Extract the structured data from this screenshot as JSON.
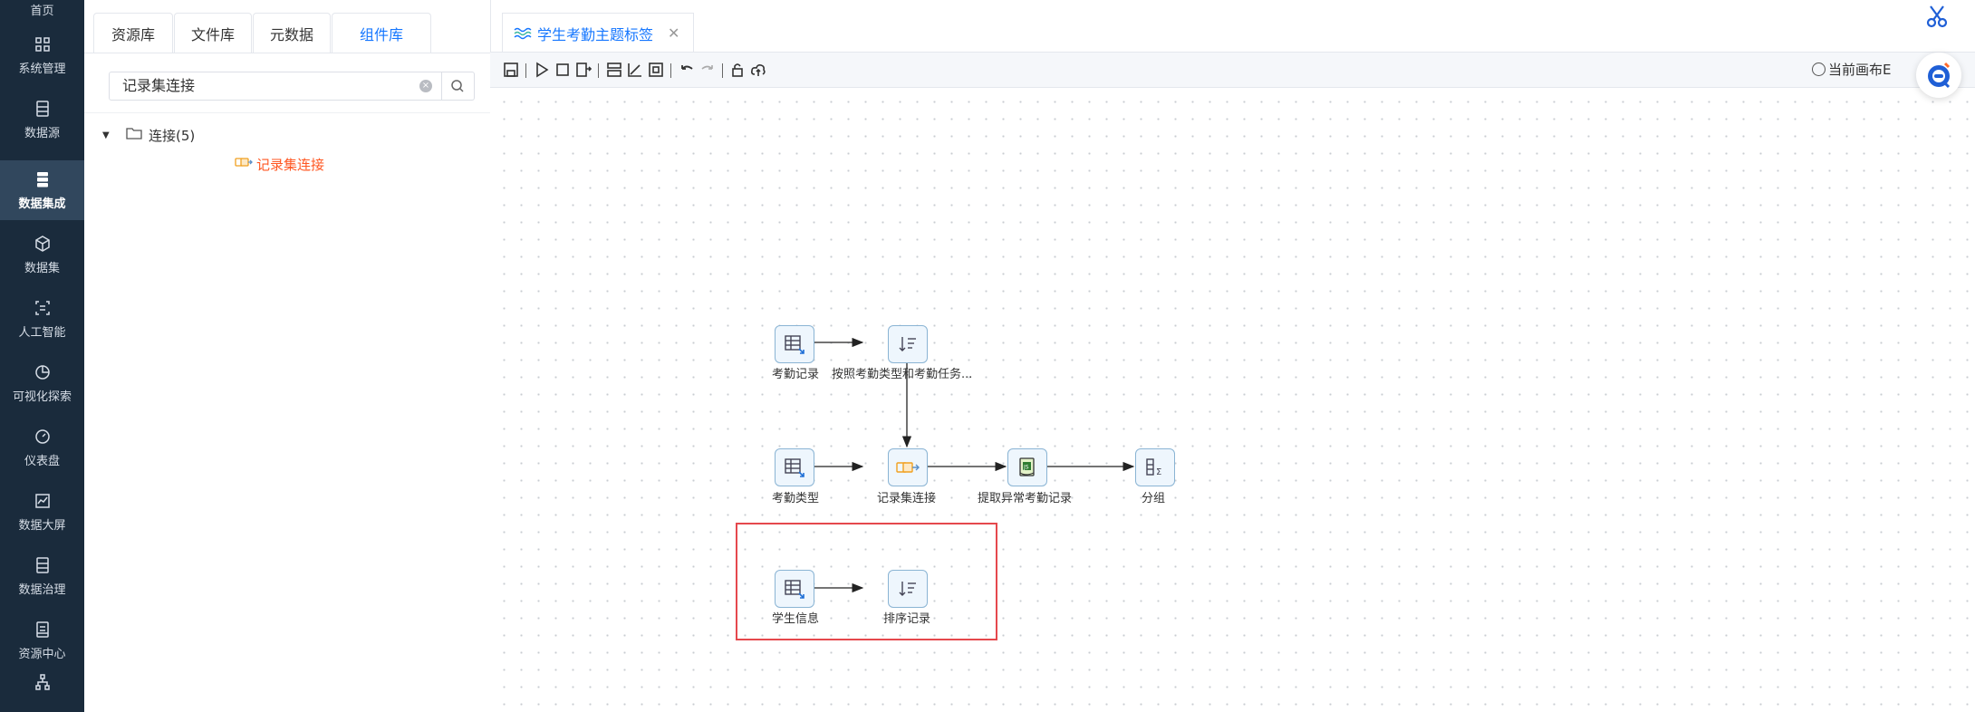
{
  "nav": {
    "top_label": "首页",
    "items": [
      {
        "label": "系统管理",
        "icon": "grid-icon"
      },
      {
        "label": "数据源",
        "icon": "database-icon"
      },
      {
        "label": "数据集成",
        "icon": "server-icon",
        "active": true
      },
      {
        "label": "数据集",
        "icon": "cube-icon"
      },
      {
        "label": "人工智能",
        "icon": "scan-icon"
      },
      {
        "label": "可视化探索",
        "icon": "pie-chart-icon"
      },
      {
        "label": "仪表盘",
        "icon": "gauge-icon"
      },
      {
        "label": "数据大屏",
        "icon": "line-chart-icon"
      },
      {
        "label": "数据治理",
        "icon": "list-box-icon"
      },
      {
        "label": "资源中心",
        "icon": "archive-icon"
      },
      {
        "label": "",
        "icon": "org-tree-icon"
      }
    ]
  },
  "left_tabs": [
    "资源库",
    "文件库",
    "元数据",
    "组件库"
  ],
  "left_active_tab": "组件库",
  "search": {
    "value": "记录集连接"
  },
  "tree": {
    "root": "连接(5)",
    "leaf": "记录集连接"
  },
  "canvas_tab": {
    "label": "学生考勤主题标签"
  },
  "toolbar": {
    "status": "当前画布E"
  },
  "nodes": {
    "n1": "考勤记录",
    "n2": "按照考勤类型和考勤任务...",
    "n3": "考勤类型",
    "n4": "记录集连接",
    "n5": "提取异常考勤记录",
    "n6": "分组",
    "n7": "学生信息",
    "n8": "排序记录"
  },
  "colors": {
    "sidebar": "#1a2b3c",
    "accent": "#1677ff",
    "highlight": "#ff5722",
    "selection": "#e5484d"
  }
}
